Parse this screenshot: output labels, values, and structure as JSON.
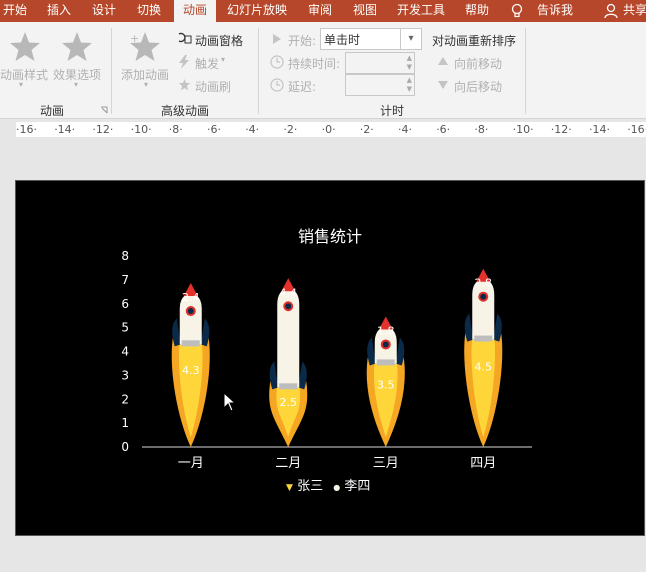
{
  "tabs": [
    {
      "label": "开始"
    },
    {
      "label": "插入"
    },
    {
      "label": "设计"
    },
    {
      "label": "切换"
    },
    {
      "label": "动画"
    },
    {
      "label": "幻灯片放映"
    },
    {
      "label": "审阅"
    },
    {
      "label": "视图"
    },
    {
      "label": "开发工具"
    },
    {
      "label": "帮助"
    },
    {
      "label": "告诉我"
    },
    {
      "label": "共享"
    }
  ],
  "ribbon": {
    "animation_styles": "动画样式",
    "effect_options": "效果选项",
    "add_animation": "添加动画",
    "animation_pane": "动画窗格",
    "trigger": "触发",
    "animation_painter": "动画刷",
    "start_label": "开始:",
    "start_value": "单击时",
    "duration_label": "持续时间:",
    "delay_label": "延迟:",
    "reorder_title": "对动画重新排序",
    "move_earlier": "向前移动",
    "move_later": "向后移动",
    "group_animation": "动画",
    "group_advanced": "高级动画",
    "group_timing": "计时"
  },
  "ruler": {
    "labels": [
      "16",
      "14",
      "12",
      "10",
      "8",
      "6",
      "4",
      "2",
      "0",
      "2",
      "4",
      "6",
      "8",
      "10",
      "12",
      "14",
      "16"
    ]
  },
  "chart_data": {
    "type": "bar",
    "title": "销售统计",
    "categories": [
      "一月",
      "二月",
      "三月",
      "四月"
    ],
    "series": [
      {
        "name": "张三",
        "values": [
          4.3,
          2.5,
          3.5,
          4.5
        ]
      },
      {
        "name": "李四",
        "values": [
          2.4,
          4.4,
          1.8,
          2.8
        ]
      }
    ],
    "stacked": true,
    "ylim": [
      0,
      8
    ],
    "yticks": [
      "0",
      "1",
      "2",
      "3",
      "4",
      "5",
      "6",
      "7",
      "8"
    ],
    "legend_position": "bottom",
    "background": "#000000",
    "flame_colors": [
      "#ffd63a",
      "#f5a623"
    ],
    "rocket_colors": [
      "#f7f3e6",
      "#e3312b",
      "#0b2a4a"
    ]
  },
  "colors": {
    "tab_bar": "#b7472a",
    "ribbon_bg": "#f3f3f3"
  }
}
